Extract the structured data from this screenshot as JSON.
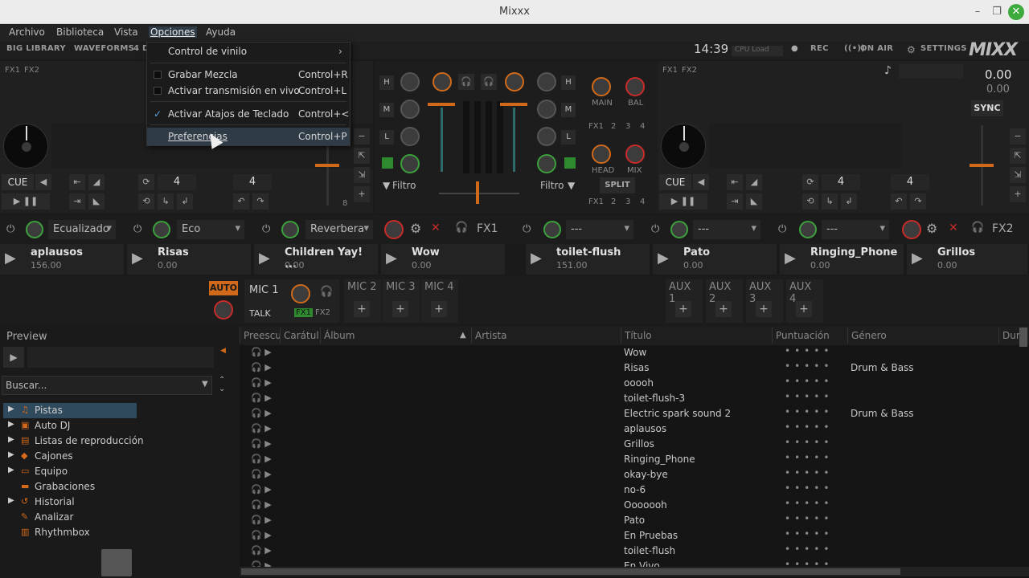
{
  "window": {
    "title": "Mixxx"
  },
  "menu": {
    "items": [
      "Archivo",
      "Biblioteca",
      "Vista",
      "Opciones",
      "Ayuda"
    ]
  },
  "toolbar": {
    "big_library": "BIG LIBRARY",
    "waveforms": "WAVEFORMS",
    "4d": "4 D",
    "clock": "14:39",
    "cpu_load": "CPU Load",
    "rec": "REC",
    "on_air": "ON AIR",
    "settings": "SETTINGS",
    "logo": "MIXX"
  },
  "dropdown": {
    "items": [
      {
        "label": "Control de vinilo",
        "shortcut": "",
        "type": "submenu"
      },
      {
        "label": "Grabar Mezcla",
        "shortcut": "Control+R",
        "type": "check",
        "checked": false
      },
      {
        "label": "Activar transmisión en vivo",
        "shortcut": "Control+L",
        "type": "check",
        "checked": false
      },
      {
        "label": "Activar Atajos de Teclado",
        "shortcut": "Control+<",
        "type": "check",
        "checked": true
      },
      {
        "label": "Preferencias",
        "shortcut": "Control+P",
        "type": "item",
        "highlighted": true
      }
    ]
  },
  "deck1": {
    "fx": [
      "FX1",
      "FX2"
    ],
    "cue": "CUE",
    "beatloop": "4",
    "beatjump": "4"
  },
  "deck2": {
    "fx": [
      "FX1",
      "FX2"
    ],
    "cue": "CUE",
    "beatloop": "4",
    "beatjump": "4",
    "rate": "0.00",
    "rate2": "0.00",
    "sync": "SYNC"
  },
  "mixer": {
    "eq_labels": [
      "H",
      "M",
      "L"
    ],
    "filter_left": "Filtro",
    "filter_right": "Filtro",
    "main": "MAIN",
    "bal": "BAL",
    "head": "HEAD",
    "mix": "MIX",
    "split": "SPLIT",
    "fx_row": [
      "FX1",
      "2",
      "3",
      "4"
    ]
  },
  "effects": {
    "unit1": "Ecualizado",
    "unit2": "Eco",
    "unit3": "Reverbera",
    "fx1": "FX1",
    "empty": "---",
    "fx2": "FX2"
  },
  "samplers": [
    {
      "name": "aplausos",
      "bpm": "156.00"
    },
    {
      "name": "Risas",
      "bpm": "0.00"
    },
    {
      "name": "Children Yay! ...",
      "bpm": "0.00"
    },
    {
      "name": "Wow",
      "bpm": "0.00"
    },
    {
      "name": "toilet-flush",
      "bpm": "151.00"
    },
    {
      "name": "Pato",
      "bpm": "0.00"
    },
    {
      "name": "Ringing_Phone",
      "bpm": "0.00"
    },
    {
      "name": "Grillos",
      "bpm": "0.00"
    }
  ],
  "mics": {
    "auto": "AUTO",
    "mic1": "MIC 1",
    "talk": "TALK",
    "fx1": "FX1",
    "fx2": "FX2",
    "mic2": "MIC 2",
    "mic3": "MIC 3",
    "mic4": "MIC 4",
    "aux": [
      "AUX 1",
      "AUX 2",
      "AUX 3",
      "AUX 4"
    ]
  },
  "library": {
    "preview": "Preview",
    "search_placeholder": "Buscar...",
    "tree": [
      "Pistas",
      "Auto DJ",
      "Listas de reproducción",
      "Cajones",
      "Equipo",
      "Grabaciones",
      "Historial",
      "Analizar",
      "Rhythmbox"
    ],
    "columns": [
      "Preescu",
      "Carátul",
      "Álbum",
      "Artista",
      "Título",
      "Puntuación",
      "Género",
      "Dur"
    ],
    "rows": [
      {
        "title": "Wow",
        "genre": ""
      },
      {
        "title": "Risas",
        "genre": "Drum & Bass"
      },
      {
        "title": "ooooh",
        "genre": ""
      },
      {
        "title": "toilet-flush-3",
        "genre": ""
      },
      {
        "title": "Electric spark sound 2",
        "genre": "Drum & Bass"
      },
      {
        "title": "aplausos",
        "genre": ""
      },
      {
        "title": "Grillos",
        "genre": ""
      },
      {
        "title": "Ringing_Phone",
        "genre": ""
      },
      {
        "title": "okay-bye",
        "genre": ""
      },
      {
        "title": "no-6",
        "genre": ""
      },
      {
        "title": "Ooooooh",
        "genre": ""
      },
      {
        "title": "Pato",
        "genre": ""
      },
      {
        "title": "En Pruebas",
        "genre": ""
      },
      {
        "title": "toilet-flush",
        "genre": ""
      },
      {
        "title": "En Vivo",
        "genre": ""
      }
    ]
  }
}
